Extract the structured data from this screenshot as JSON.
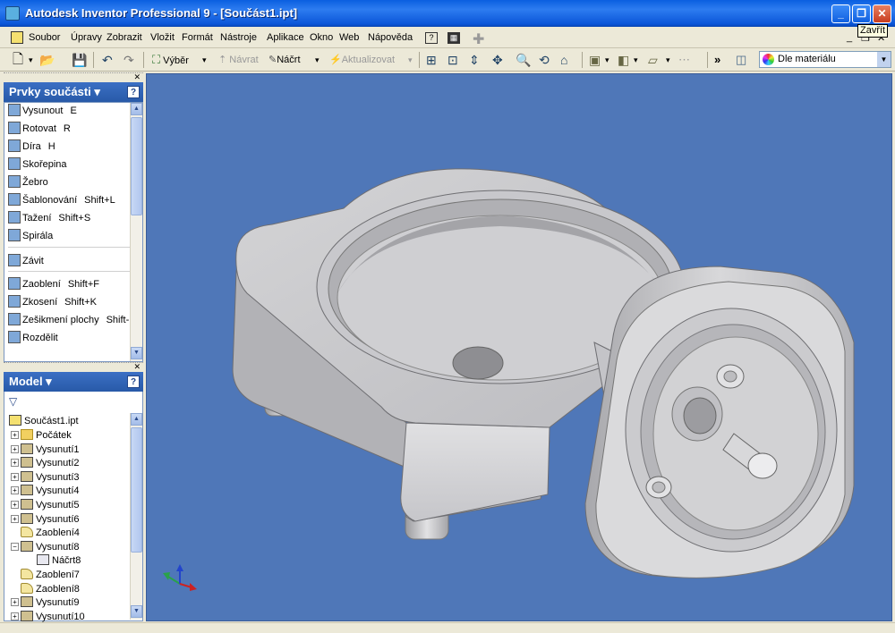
{
  "window": {
    "title": "Autodesk Inventor Professional 9 - [Součást1.ipt]",
    "minimize": "_",
    "restore": "❐",
    "close": "✕",
    "tooltip": "Zavřít"
  },
  "menu": [
    "Soubor",
    "Úpravy",
    "Zobrazit",
    "Vložit",
    "Formát",
    "Nástroje",
    "Aplikace",
    "Okno",
    "Web",
    "Nápověda"
  ],
  "toolbar": {
    "select": "Výběr",
    "back": "Návrat",
    "sketch": "Náčrt",
    "update": "Aktualizovat",
    "material": "Dle materiálu"
  },
  "features_panel": {
    "title": "Prvky součásti ▾",
    "help": "?",
    "items": [
      {
        "label": "Vysunout",
        "key": "E"
      },
      {
        "label": "Rotovat",
        "key": "R"
      },
      {
        "label": "Díra",
        "key": "H"
      },
      {
        "label": "Skořepina",
        "key": ""
      },
      {
        "label": "Žebro",
        "key": ""
      },
      {
        "label": "Šablonování",
        "key": "Shift+L"
      },
      {
        "label": "Tažení",
        "key": "Shift+S"
      },
      {
        "label": "Spirála",
        "key": ""
      },
      {
        "label": "Závit",
        "key": ""
      },
      {
        "label": "Zaoblení",
        "key": "Shift+F"
      },
      {
        "label": "Zkosení",
        "key": "Shift+K"
      },
      {
        "label": "Zešikmení plochy",
        "key": "Shift-"
      },
      {
        "label": "Rozdělit",
        "key": ""
      }
    ]
  },
  "model_panel": {
    "title": "Model ▾",
    "help": "?",
    "root": "Součást1.ipt",
    "items": [
      {
        "label": "Počátek",
        "kind": "folder",
        "level": 1,
        "expand": "+"
      },
      {
        "label": "Vysunutí1",
        "kind": "feature",
        "level": 1,
        "expand": "+"
      },
      {
        "label": "Vysunutí2",
        "kind": "feature",
        "level": 1,
        "expand": "+"
      },
      {
        "label": "Vysunutí3",
        "kind": "feature",
        "level": 1,
        "expand": "+"
      },
      {
        "label": "Vysunutí4",
        "kind": "feature",
        "level": 1,
        "expand": "+"
      },
      {
        "label": "Vysunutí5",
        "kind": "feature",
        "level": 1,
        "expand": "+"
      },
      {
        "label": "Vysunutí6",
        "kind": "feature",
        "level": 1,
        "expand": "+"
      },
      {
        "label": "Zaoblení4",
        "kind": "fillet",
        "level": 1,
        "expand": ""
      },
      {
        "label": "Vysunutí8",
        "kind": "feature",
        "level": 1,
        "expand": "−"
      },
      {
        "label": "Náčrt8",
        "kind": "sketch",
        "level": 2,
        "expand": ""
      },
      {
        "label": "Zaoblení7",
        "kind": "fillet",
        "level": 1,
        "expand": ""
      },
      {
        "label": "Zaoblení8",
        "kind": "fillet",
        "level": 1,
        "expand": ""
      },
      {
        "label": "Vysunutí9",
        "kind": "feature",
        "level": 1,
        "expand": "+"
      },
      {
        "label": "Vysunutí10",
        "kind": "feature",
        "level": 1,
        "expand": "+"
      }
    ]
  },
  "colors": {
    "viewport_bg": "#4f77b8",
    "titlebar": "#0a5fe0",
    "panel_header": "#3b6fc4"
  }
}
